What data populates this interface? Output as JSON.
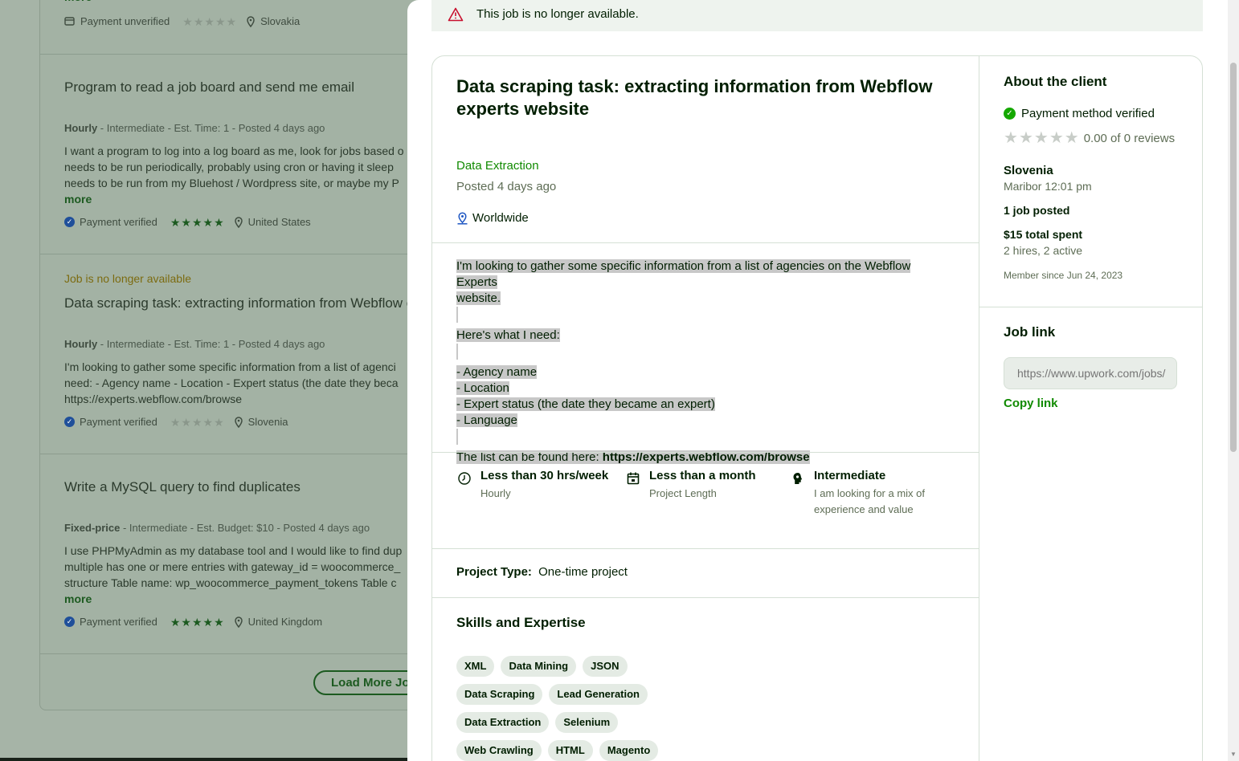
{
  "background": {
    "cards": [
      {
        "more_label": "more",
        "payment": "Payment unverified",
        "rating": 0,
        "location": "Slovakia"
      },
      {
        "title": "Program to read a job board and send me email",
        "meta_type": "Hourly",
        "meta_rest": " - Intermediate - Est. Time: 1 - Posted 4 days ago",
        "desc_lines": [
          "I want a program to log into a log board as me, look for jobs based o",
          "needs to be run periodically, probably using cron or having it sleep",
          "needs to be run from my Bluehost / Wordpress site, or maybe my P"
        ],
        "more_label": "more",
        "payment": "Payment verified",
        "rating": 5,
        "location": "United States"
      },
      {
        "status": "Job is no longer available",
        "title": "Data scraping task: extracting information from Webflow e",
        "meta_type": "Hourly",
        "meta_rest": " - Intermediate - Est. Time: 1 - Posted 4 days ago",
        "desc_lines": [
          "I'm looking to gather some specific information from a list of agenci",
          "need: - Agency name - Location - Expert status (the date they beca",
          "https://experts.webflow.com/browse"
        ],
        "payment": "Payment verified",
        "rating": 0,
        "location": "Slovenia"
      },
      {
        "title": "Write a MySQL query to find duplicates",
        "meta_type": "Fixed-price",
        "meta_rest": " - Intermediate - Est. Budget: $10 - Posted 4 days ago",
        "desc_lines": [
          "I use PHPMyAdmin as my database tool and I would like to find dup",
          "multiple has one or mere entries with gateway_id = woocommerce_",
          "structure Table name: wp_woocommerce_payment_tokens Table c"
        ],
        "more_label": "more",
        "payment": "Payment verified",
        "rating": 5,
        "location": "United Kingdom"
      }
    ],
    "load_more": "Load More Jobs"
  },
  "alert": {
    "text": "This job is no longer available."
  },
  "job": {
    "title": "Data scraping task: extracting information from Webflow experts website",
    "category": "Data Extraction",
    "posted": "Posted 4 days ago",
    "location": "Worldwide",
    "description": {
      "intro_1": "I'm looking to gather some specific information from a list of agencies on the Webflow Experts",
      "intro_2": "website.",
      "need": "Here's what I need:",
      "items": [
        "- Agency name",
        "- Location",
        "- Expert status (the date they became an expert)",
        "- Language"
      ],
      "list_prefix": "The list can be found here: ",
      "list_url": "https://experts.webflow.com/browse"
    },
    "features": [
      {
        "icon": "clock-icon",
        "title": "Less than 30 hrs/week",
        "sub": "Hourly"
      },
      {
        "icon": "calendar-icon",
        "title": "Less than a month",
        "sub": "Project Length"
      },
      {
        "icon": "brain-icon",
        "title": "Intermediate",
        "sub_1": "I am looking for a mix of",
        "sub_2": "experience and value"
      }
    ],
    "project_type_label": "Project Type:",
    "project_type_value": "One-time project",
    "skills_heading": "Skills and Expertise",
    "skills_rows": [
      [
        "XML",
        "Data Mining",
        "JSON"
      ],
      [
        "Data Scraping",
        "Lead Generation"
      ],
      [
        "Data Extraction",
        "Selenium"
      ],
      [
        "Web Crawling",
        "HTML",
        "Magento"
      ]
    ]
  },
  "client": {
    "heading": "About the client",
    "payment": "Payment method verified",
    "rating_text": "0.00 of 0 reviews",
    "rating": 0,
    "country": "Slovenia",
    "city_time": "Maribor 12:01 pm",
    "jobs_posted": "1 job posted",
    "spent": "$15 total spent",
    "hires": "2 hires, 2 active",
    "member_since": "Member since Jun 24, 2023"
  },
  "job_link": {
    "heading": "Job link",
    "placeholder": "https://www.upwork.com/jobs/",
    "copy_label": "Copy link"
  },
  "colors": {
    "accent": "#108a00",
    "overlay": "#a3b2a4",
    "text": "#001e00"
  }
}
